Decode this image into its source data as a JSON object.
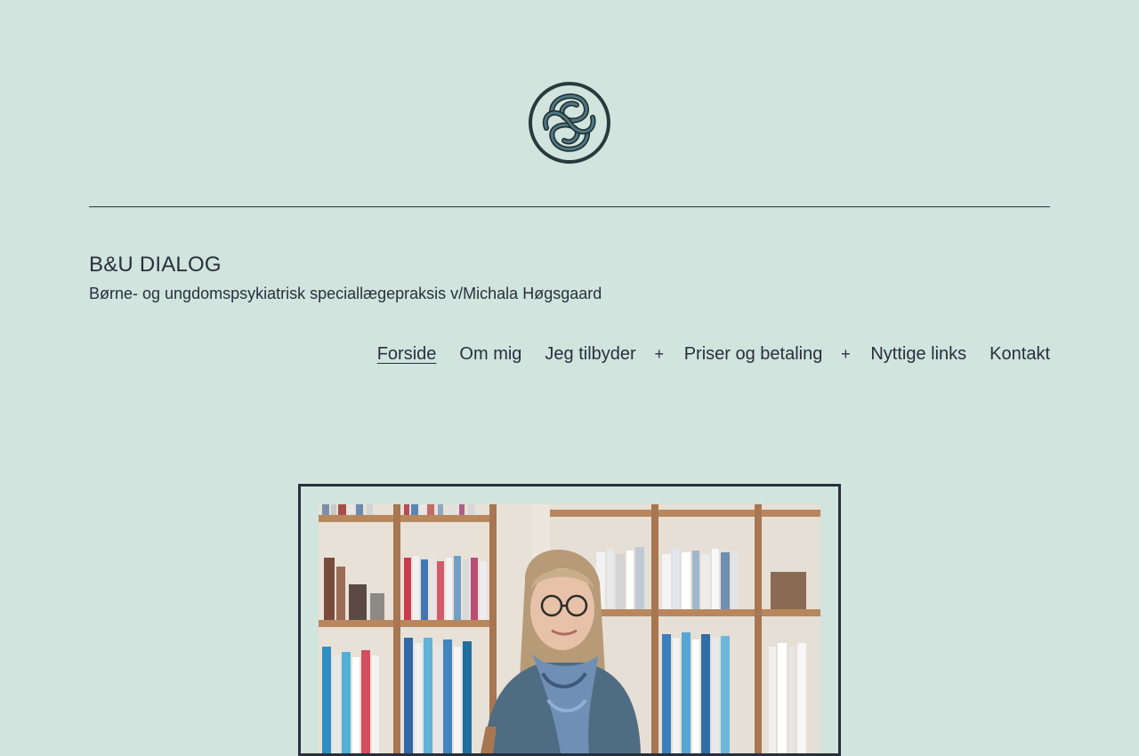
{
  "site": {
    "title": "B&U DIALOG",
    "tagline": "Børne- og ungdomspsykiatrisk speciallægepraksis v/Michala Høgsgaard",
    "logo_icon": "celtic-knot-logo-icon"
  },
  "nav": {
    "items": [
      {
        "label": "Forside",
        "current": true
      },
      {
        "label": "Om mig"
      },
      {
        "label": "Jeg tilbyder",
        "has_submenu": true
      },
      {
        "label": "Priser og betaling",
        "has_submenu": true
      },
      {
        "label": "Nyttige links"
      },
      {
        "label": "Kontakt"
      }
    ],
    "submenu_toggle_symbol": "+"
  },
  "hero_image": {
    "subject": "portrait-photo"
  },
  "colors": {
    "background": "#d1e4dd",
    "text": "#28303d",
    "logo_ring": "#1f2b2c",
    "logo_knot": "#3d6470"
  }
}
